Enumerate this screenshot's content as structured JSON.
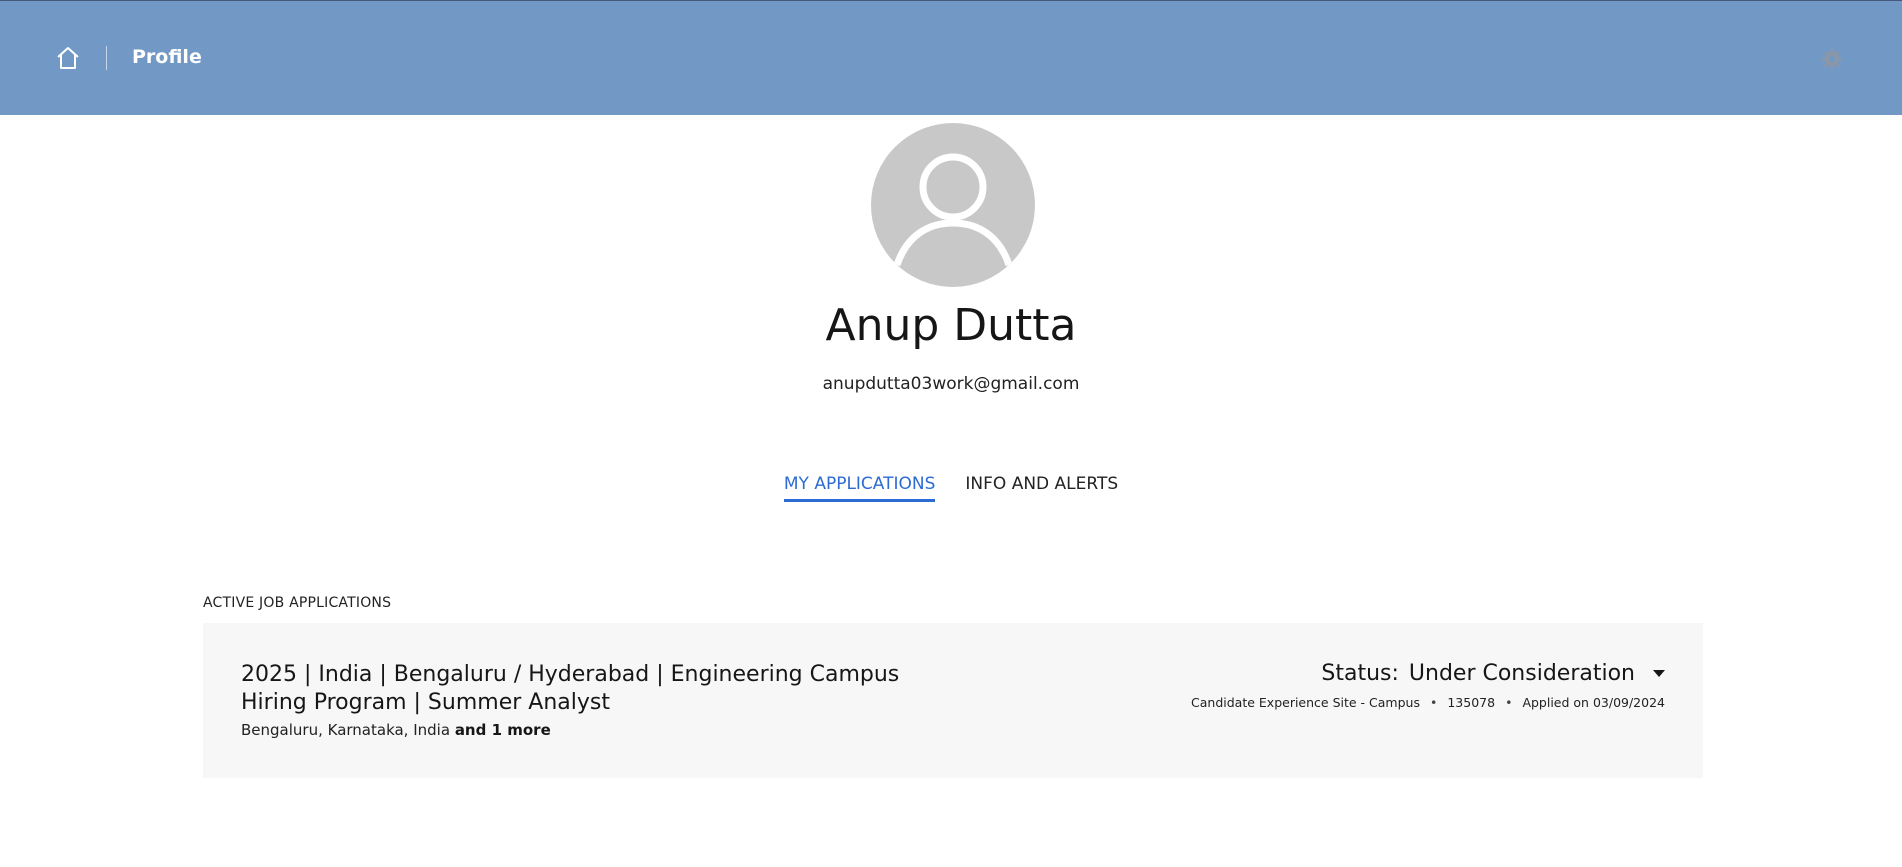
{
  "header": {
    "title": "Profile",
    "home_icon": "home-icon",
    "settings_icon": "gear-icon",
    "bg_color": "#7298c6"
  },
  "profile": {
    "avatar_icon": "user-avatar-icon",
    "name": "Anup Dutta",
    "email": "anupdutta03work@gmail.com"
  },
  "tabs": [
    {
      "label": "MY APPLICATIONS",
      "active": true
    },
    {
      "label": "INFO AND ALERTS",
      "active": false
    }
  ],
  "accent_color": "#2c6bd1",
  "applications": {
    "section_label": "ACTIVE JOB APPLICATIONS",
    "items": [
      {
        "title": "2025 | India | Bengaluru / Hyderabad | Engineering Campus Hiring Program | Summer Analyst",
        "location": "Bengaluru, Karnataka, India",
        "location_more": "and 1 more",
        "status_prefix": "Status:",
        "status": "Under Consideration",
        "site": "Candidate Experience Site - Campus",
        "separator": "•",
        "job_id": "135078",
        "applied": "Applied on 03/09/2024"
      }
    ]
  }
}
